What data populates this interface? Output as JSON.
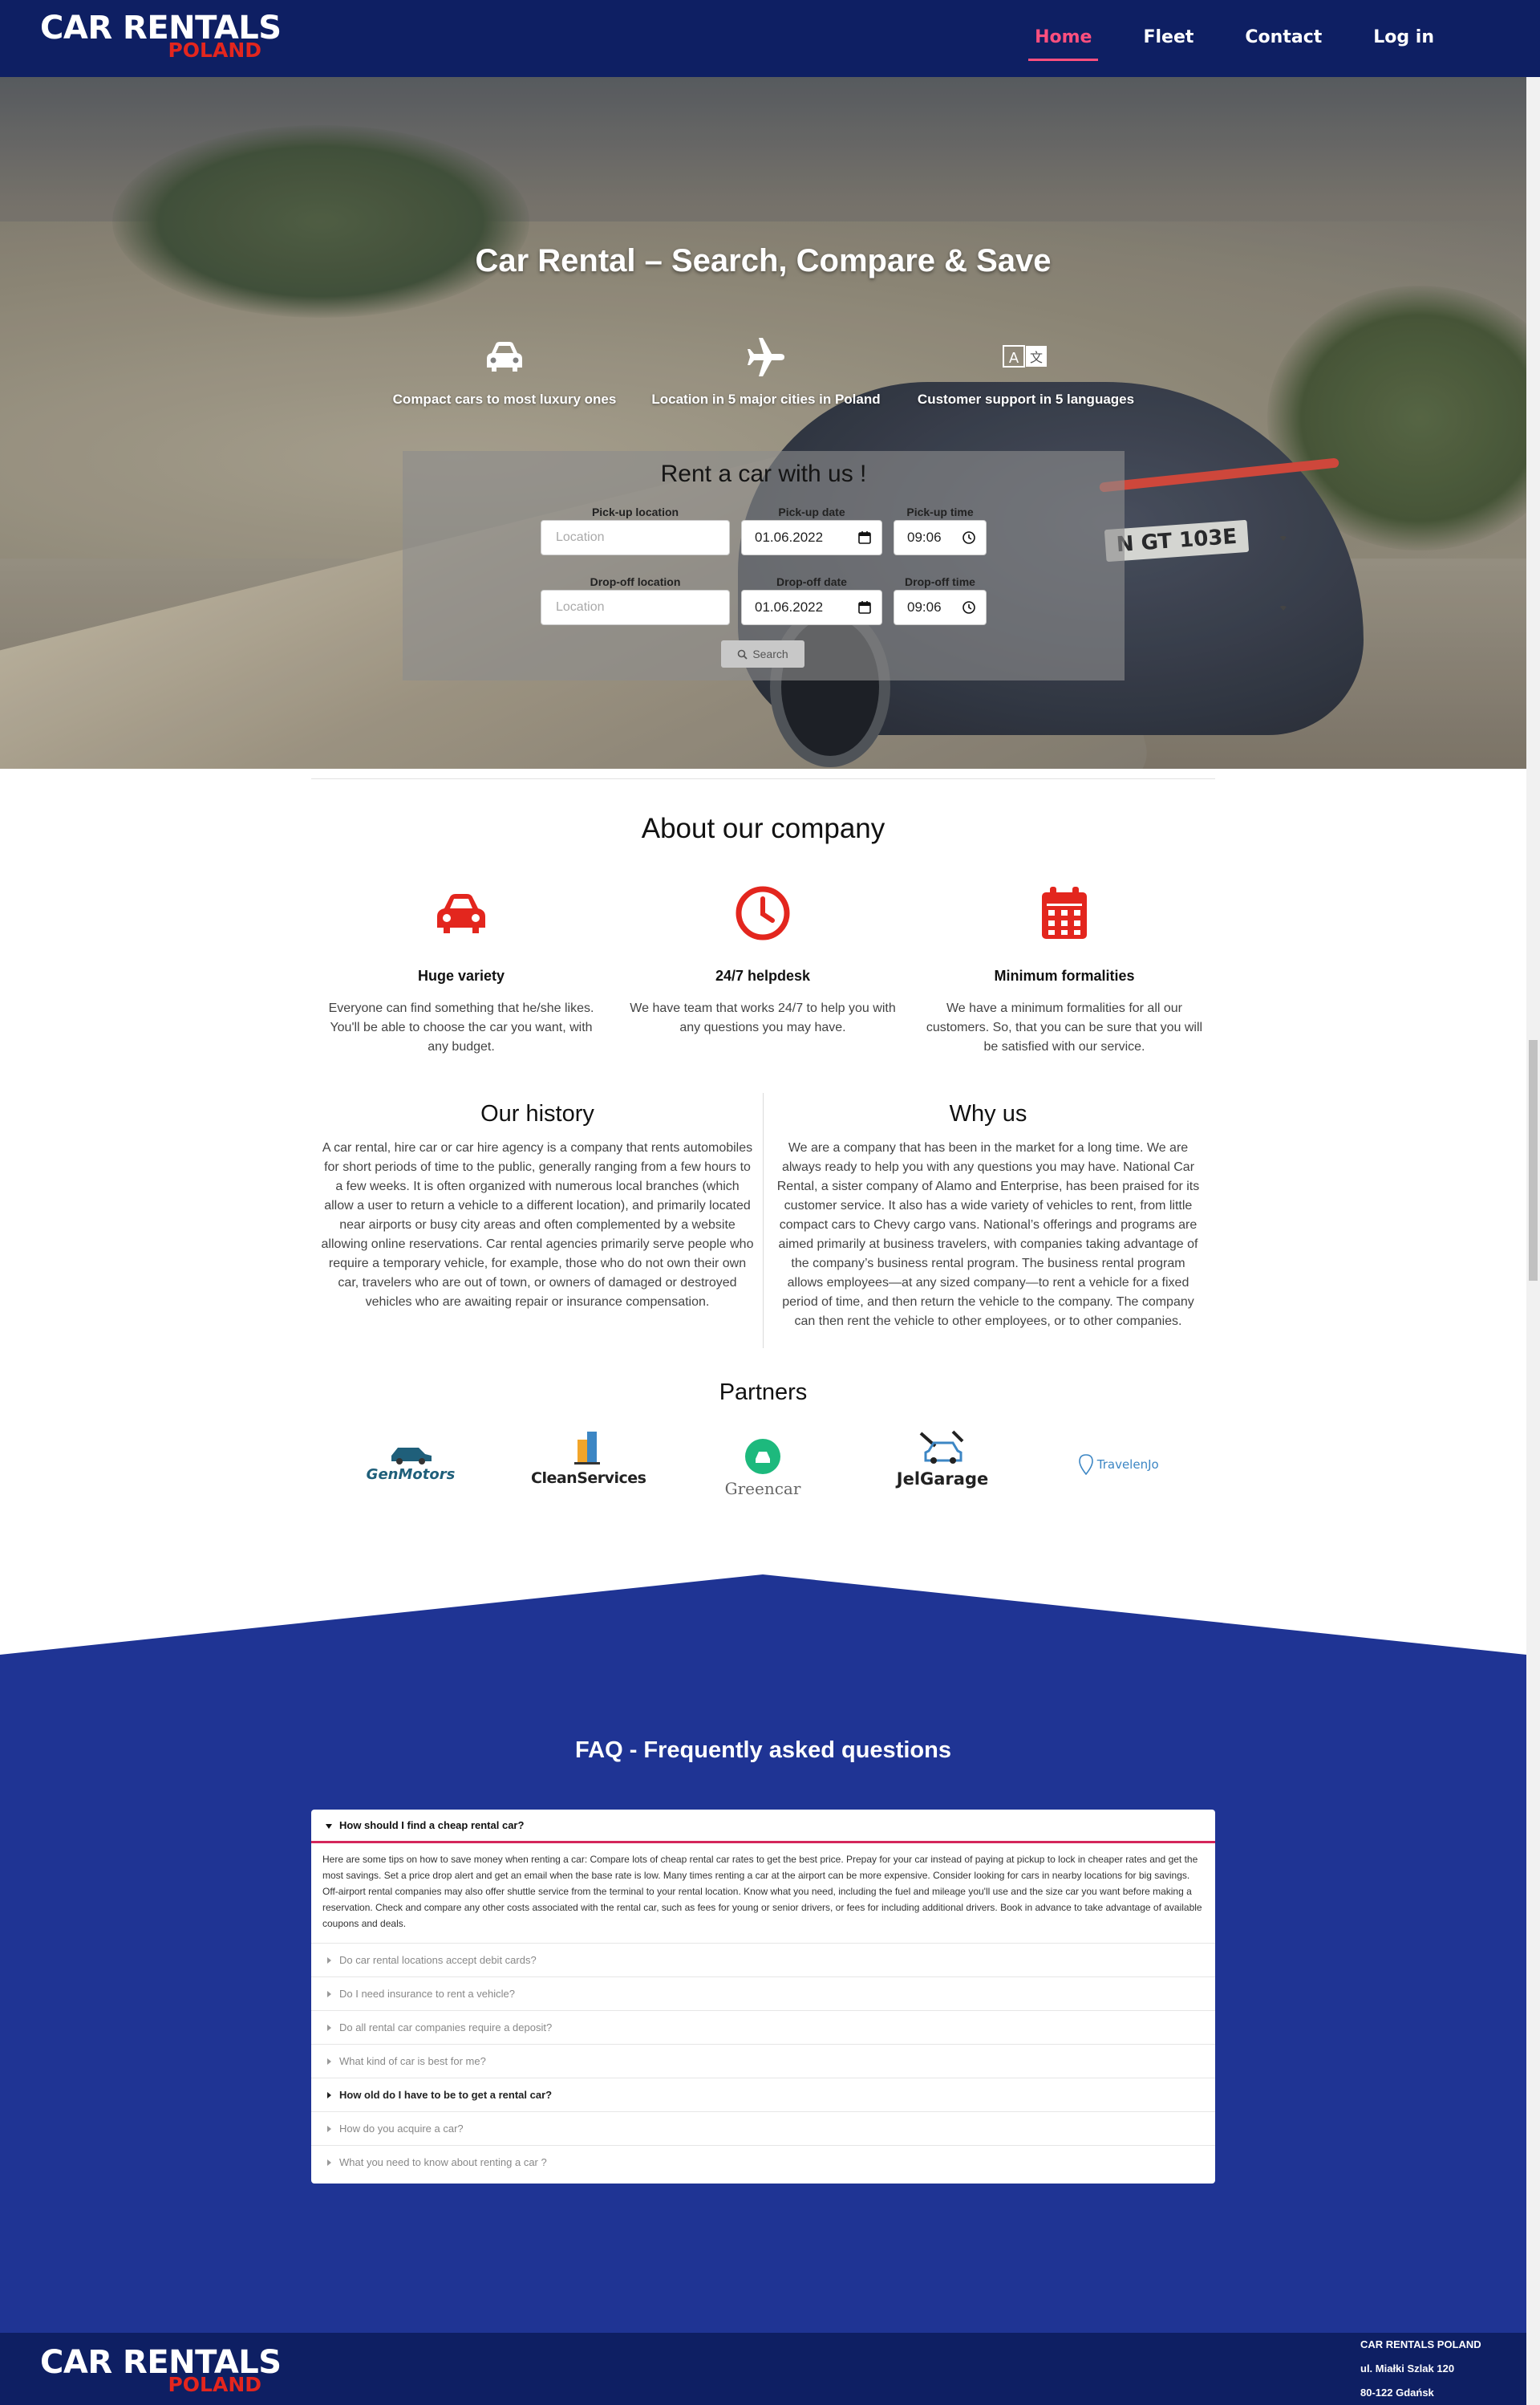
{
  "brand": {
    "line1": "CAR RENTALS",
    "line2": "POLAND",
    "accent": "#e3261e",
    "navy": "#0e1f63"
  },
  "nav": {
    "items": [
      "Home",
      "Fleet",
      "Contact",
      "Log in"
    ],
    "active": "Home"
  },
  "hero": {
    "title": "Car Rental – Search, Compare & Save",
    "features": [
      {
        "icon": "car-icon",
        "text": "Compact cars to most luxury ones"
      },
      {
        "icon": "airplane-icon",
        "text": "Location in 5 major cities in Poland"
      },
      {
        "icon": "language-icon",
        "text": "Customer support in 5 languages"
      }
    ],
    "plate": "N GT 103E"
  },
  "form": {
    "title": "Rent a car with us !",
    "pickup_location_label": "Pick-up location",
    "pickup_date_label": "Pick-up date",
    "pickup_time_label": "Pick-up time",
    "dropoff_location_label": "Drop-off location",
    "dropoff_date_label": "Drop-off date",
    "dropoff_time_label": "Drop-off time",
    "location_placeholder": "Location",
    "pickup_date": "01.06.2022",
    "pickup_time": "09:06",
    "dropoff_date": "01.06.2022",
    "dropoff_time": "09:06",
    "search_label": "Search"
  },
  "about": {
    "title": "About our company",
    "items": [
      {
        "icon": "car-icon",
        "title": "Huge variety",
        "text": "Everyone can find something that he/she likes. You'll be able to choose the car you want, with any budget."
      },
      {
        "icon": "clock-icon",
        "title": "24/7 helpdesk",
        "text": "We have team that works 24/7 to help you with any questions you may have."
      },
      {
        "icon": "calendar-icon",
        "title": "Minimum formalities",
        "text": "We have a minimum formalities for all our customers. So, that you can be sure that you will be satisfied with our service."
      }
    ]
  },
  "history": {
    "title": "Our history",
    "text": "A car rental, hire car or car hire agency is a company that rents automobiles for short periods of time to the public, generally ranging from a few hours to a few weeks. It is often organized with numerous local branches (which allow a user to return a vehicle to a different location), and primarily located near airports or busy city areas and often complemented by a website allowing online reservations. Car rental agencies primarily serve people who require a temporary vehicle, for example, those who do not own their own car, travelers who are out of town, or owners of damaged or destroyed vehicles who are awaiting repair or insurance compensation."
  },
  "why": {
    "title": "Why us",
    "text": "We are a company that has been in the market for a long time. We are always ready to help you with any questions you may have. National Car Rental, a sister company of Alamo and Enterprise, has been praised for its customer service. It also has a wide variety of vehicles to rent, from little compact cars to Chevy cargo vans. National’s offerings and programs are aimed primarily at business travelers, with companies taking advantage of the company’s business rental program. The business rental program allows employees—at any sized company—to rent a vehicle for a fixed period of time, and then return the vehicle to the company. The company can then rent the vehicle to other employees, or to other companies."
  },
  "partners": {
    "title": "Partners",
    "names": [
      "GenMotors",
      "CleanServices",
      "Greencar",
      "JelGarage",
      "TravelenJo"
    ]
  },
  "faq": {
    "title": "FAQ - Frequently asked questions",
    "questions": [
      "How should I find a cheap rental car?",
      "Do car rental locations accept debit cards?",
      "Do I need insurance to rent a vehicle?",
      "Do all rental car companies require a deposit?",
      "What kind of car is best for me?",
      "How old do I have to be to get a rental car?",
      "How do you acquire a car?",
      "What you need to know about renting a car ?"
    ],
    "answer": "Here are some tips on how to save money when renting a car: Compare lots of cheap rental car rates to get the best price. Prepay for your car instead of paying at pickup to lock in cheaper rates and get the most savings. Set a price drop alert and get an email when the base rate is low. Many times renting a car at the airport can be more expensive. Consider looking for cars in nearby locations for big savings. Off-airport rental companies may also offer shuttle service from the terminal to your rental location. Know what you need, including the fuel and mileage you'll use and the size car you want before making a reservation. Check and compare any other costs associated with the rental car, such as fees for young or senior drivers, or fees for including additional drivers. Book in advance to take advantage of available coupons and deals."
  },
  "footer": {
    "address": [
      "CAR RENTALS POLAND",
      "ul. Miałki Szlak 120",
      "80-122 Gdańsk"
    ]
  }
}
